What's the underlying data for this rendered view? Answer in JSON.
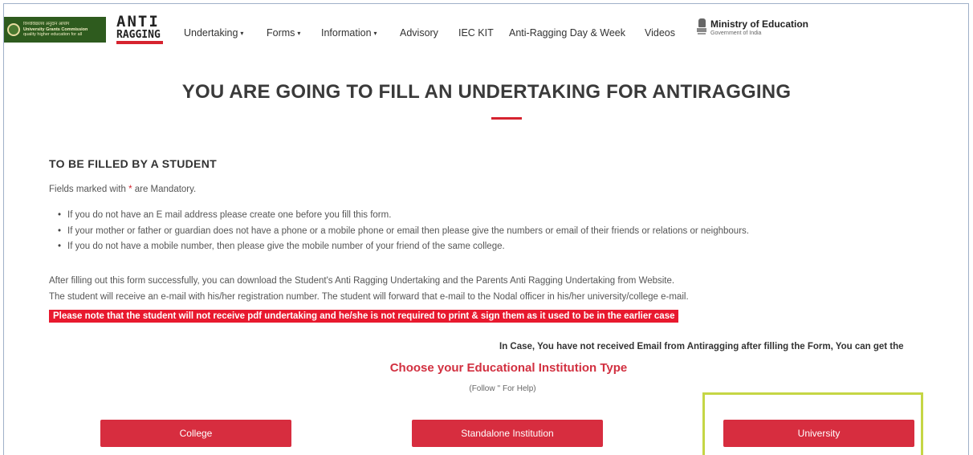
{
  "header": {
    "ugc_logo_lines": [
      "विश्वविद्यालय अनुदान आयोग",
      "University Grants Commission",
      "quality higher education for all"
    ],
    "anti_logo_top": "ANTI",
    "anti_logo_bottom": "RAGGING",
    "nav": [
      {
        "label": "Undertaking",
        "caret": "▾"
      },
      {
        "label": "Forms",
        "caret": "▾"
      },
      {
        "label": "Information",
        "caret": "▾"
      },
      {
        "label": "Advisory"
      },
      {
        "label": "IEC KIT"
      },
      {
        "label": "Anti-Ragging Day & Week"
      },
      {
        "label": "Videos"
      }
    ],
    "moe_title": "Ministry of Education",
    "moe_subtitle": "Government of India"
  },
  "main": {
    "title": "YOU ARE GOING TO FILL AN UNDERTAKING FOR ANTIRAGGING",
    "section_title": "TO BE FILLED BY A STUDENT",
    "mandatory_before": "Fields marked with ",
    "mandatory_star": "*",
    "mandatory_after": " are Mandatory.",
    "bullets": [
      "If you do not have an E mail address please create one before you fill this form.",
      "If your mother or father or guardian does not have a phone or a mobile phone or email then please give the numbers or email of their friends or relations or neighbours.",
      "If you do not have a mobile number, then please give the mobile number of your friend of the same college."
    ],
    "para1": "After filling out this form successfully, you can download the Student's Anti Ragging Undertaking and the Parents Anti Ragging Undertaking from Website.",
    "para2": "The student will receive an e-mail with his/her registration number. The student will forward that e-mail to the Nodal officer in his/her university/college e-mail.",
    "note": "Please note that the student will not receive pdf undertaking and he/she is not required to print & sign them as it used to be in the earlier case",
    "email_note": "In Case, You have not received Email from Antiragging after filling the Form, You can get the",
    "choose_title": "Choose your Educational Institution Type",
    "help": "(Follow '' For Help)"
  },
  "institution_buttons": {
    "college": "College",
    "standalone": "Standalone Institution",
    "university": "University"
  },
  "colors": {
    "accent_red": "#d72d3f",
    "note_red": "#e8192e",
    "highlight_green": "#c5d645",
    "ugc_green": "#2e5b1e"
  }
}
